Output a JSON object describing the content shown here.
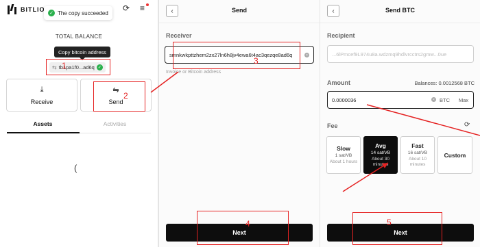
{
  "screen1": {
    "app_name": "BITLIO",
    "toast_text": "The copy succeeded",
    "total_balance_label": "TOTAL BALANCE",
    "tooltip_text": "Copy bitcoin address",
    "address_short": "tb1pa1f0...ad6q",
    "receive_label": "Receive",
    "send_label": "Send",
    "tabs": [
      "Assets",
      "Activities"
    ],
    "icons": [
      "logo-icon",
      "check-icon",
      "refresh-icon",
      "menu-icon",
      "copy-icon",
      "download-icon",
      "transfer-icon",
      "loading-icon"
    ]
  },
  "screen2": {
    "title": "Send",
    "receiver_label": "Receiver",
    "receiver_value": "smnkwkpttzhem2zx27ln6h8jv4ewa6t4ac3qezqe8ad6q",
    "receiver_helper": "Invoice or Bitcoin address",
    "next_label": "Next"
  },
  "screen3": {
    "title": "Send BTC",
    "recipient_label": "Recipient",
    "recipient_value": "...6lPmcef9L974u8a.wdzmq9hdlvrcctrs2gmw...0ue",
    "amount_label": "Amount",
    "balances_text": "Balances: 0.0012568 BTC",
    "amount_value": "0.0000036",
    "amount_unit": "BTC",
    "max_label": "Max",
    "fee_label": "Fee",
    "fee_options": [
      {
        "name": "Slow",
        "rate": "1 sat/VB",
        "time": "About 1 hours",
        "selected": false
      },
      {
        "name": "Avg",
        "rate": "14 sat/VB",
        "time": "About 30 minutes",
        "selected": true
      },
      {
        "name": "Fast",
        "rate": "16 sat/VB",
        "time": "About 10 minutes",
        "selected": false
      }
    ],
    "custom_label": "Custom",
    "next_label": "Next"
  },
  "annotations": [
    "1",
    "2",
    "3",
    "4",
    "5"
  ],
  "colors": {
    "annotation": "#e52222",
    "success": "#2bb14d",
    "primary": "#0d0d0d"
  }
}
